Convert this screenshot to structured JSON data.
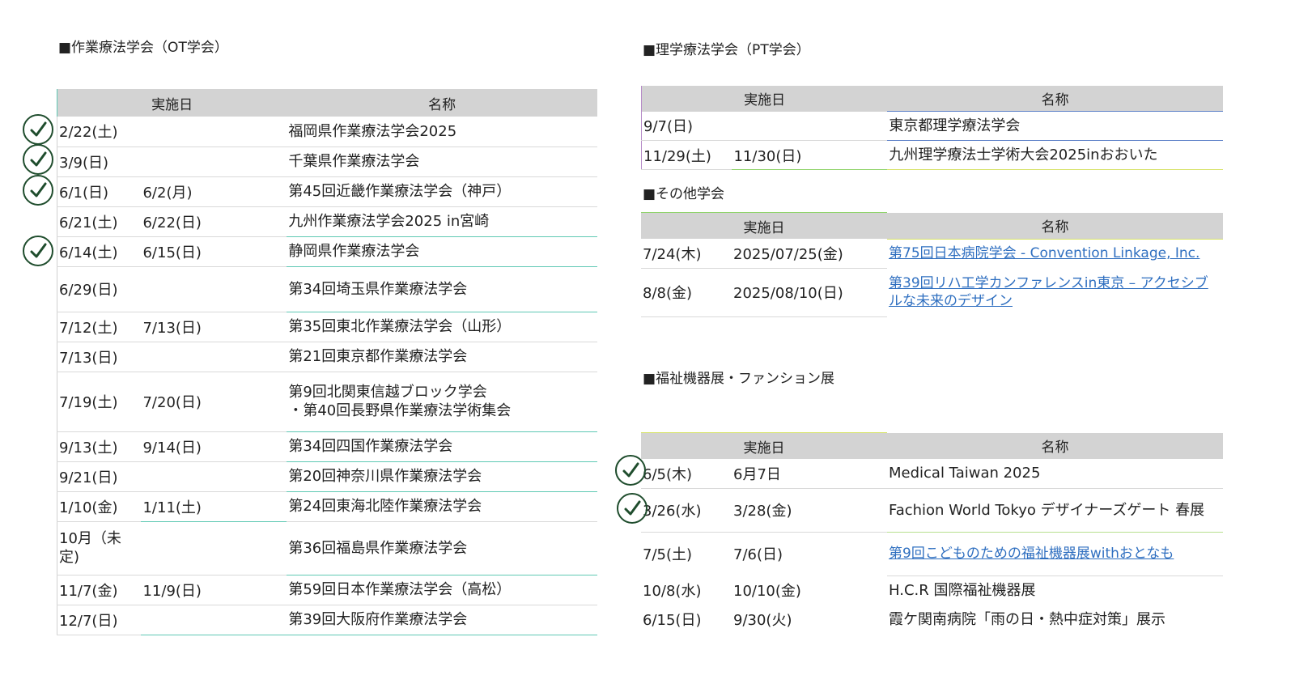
{
  "ot": {
    "title": "■作業療法学会（OT学会）",
    "headers": [
      "実施日",
      "名称"
    ],
    "rows": [
      {
        "d1": "2/22(土)",
        "d2": "",
        "name": "福岡県作業療法学会2025",
        "checked": true
      },
      {
        "d1": "3/9(日)",
        "d2": "",
        "name": "千葉県作業療法学会",
        "checked": true
      },
      {
        "d1": "6/1(日)",
        "d2": "6/2(月)",
        "name": "第45回近畿作業療法学会（神戸）",
        "checked": true
      },
      {
        "d1": "6/21(土)",
        "d2": "6/22(日)",
        "name": "九州作業療法学会2025 in宮崎",
        "checked": false
      },
      {
        "d1": "6/14(土)",
        "d2": "6/15(日)",
        "name": "静岡県作業療法学会",
        "checked": true
      },
      {
        "d1": "6/29(日)",
        "d2": "",
        "name": "第34回埼玉県作業療法学会",
        "checked": false
      },
      {
        "d1": "7/12(土)",
        "d2": "7/13(日)",
        "name": "第35回東北作業療法学会（山形）",
        "checked": false
      },
      {
        "d1": "7/13(日)",
        "d2": "",
        "name": "第21回東京都作業療法学会",
        "checked": false
      },
      {
        "d1": "7/19(土)",
        "d2": "7/20(日)",
        "name": "第9回北関東信越ブロック学会",
        "name2": "・第40回長野県作業療法学術集会",
        "checked": false
      },
      {
        "d1": "9/13(土)",
        "d2": "9/14(日)",
        "name": "第34回四国作業療法学会",
        "checked": false
      },
      {
        "d1": "9/21(日)",
        "d2": "",
        "name": "第20回神奈川県作業療法学会",
        "checked": false
      },
      {
        "d1": "1/10(金)",
        "d2": "1/11(土)",
        "name": "第24回東海北陸作業療法学会",
        "checked": false
      },
      {
        "d1": "10月（未",
        "d1b": "定)",
        "d2": "",
        "name": "第36回福島県作業療法学会",
        "checked": false
      },
      {
        "d1": "11/7(金)",
        "d2": "11/9(日)",
        "name": "第59回日本作業療法学会（高松）",
        "checked": false
      },
      {
        "d1": "12/7(日)",
        "d2": "",
        "name": "第39回大阪府作業療法学会",
        "checked": false
      }
    ]
  },
  "pt": {
    "title": "■理学療法学会（PT学会）",
    "headers": [
      "実施日",
      "名称"
    ],
    "rows": [
      {
        "d1": "9/7(日)",
        "d2": "",
        "name": "東京都理学療法学会"
      },
      {
        "d1": "11/29(土)",
        "d2": "11/30(日)",
        "name": "九州理学療法士学術大会2025inおおいた"
      }
    ]
  },
  "other": {
    "title": "■その他学会",
    "headers": [
      "実施日",
      "名称"
    ],
    "rows": [
      {
        "d1": "7/24(木)",
        "d2": "2025/07/25(金)",
        "name": "第75回日本病院学会 - Convention Linkage, Inc.",
        "link": true
      },
      {
        "d1": "8/8(金)",
        "d2": "2025/08/10(日)",
        "name": "第39回リハ工学カンファレンスin東京 – アクセシブ",
        "name2": "ルな未来のデザイン",
        "link": true
      }
    ]
  },
  "welfare": {
    "title": "■福祉機器展・ファンション展",
    "headers": [
      "実施日",
      "名称"
    ],
    "rows": [
      {
        "d1": "6/5(木)",
        "d2": "6月7日",
        "name": "Medical Taiwan 2025",
        "checked": true
      },
      {
        "d1": "3/26(水)",
        "d2": "3/28(金)",
        "name": "Fachion World Tokyo デザイナーズゲート 春展",
        "checked": true
      },
      {
        "d1": "7/5(土)",
        "d2": "7/6(日)",
        "name": "第9回こどものための福祉機器展withおとなも",
        "link": true
      },
      {
        "d1": "10/8(水)",
        "d2": "10/10(金)",
        "name": "H.C.R 国際福祉機器展"
      },
      {
        "d1": "6/15(日)",
        "d2": "9/30(火)",
        "name": "霞ケ関南病院「雨の日・熱中症対策」展示"
      }
    ]
  },
  "colors": {
    "header_bg": "#d3d3d3",
    "link": "#2f6fc0",
    "check": "#1f4d2d",
    "accent_line": "#5fc9b4"
  },
  "icons": {
    "check": "checkmark-circle-icon"
  }
}
